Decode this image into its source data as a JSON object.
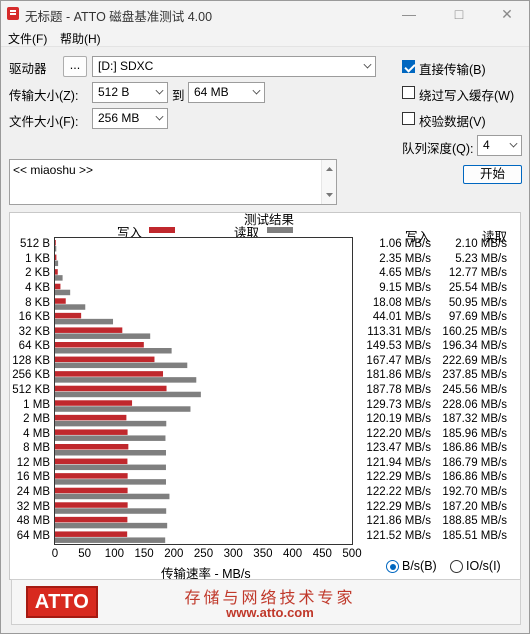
{
  "window": {
    "title": "无标题 - ATTO 磁盘基准测试 4.00"
  },
  "menu": {
    "file": "文件(F)",
    "help": "帮助(H)"
  },
  "controls": {
    "drive_label": "驱动器",
    "browse_button": "...",
    "drive_value": "[D:] SDXC",
    "transfer_size_label": "传输大小(Z):",
    "transfer_from": "512 B",
    "transfer_to_label": "到",
    "transfer_to": "64 MB",
    "file_size_label": "文件大小(F):",
    "file_size": "256 MB",
    "direct_io_label": "直接传输(B)",
    "direct_io_checked": true,
    "bypass_write_cache_label": "绕过写入缓存(W)",
    "bypass_write_cache_checked": false,
    "verify_data_label": "校验数据(V)",
    "verify_data_checked": false,
    "queue_depth_label": "队列深度(Q):",
    "queue_depth": "4",
    "start_button": "开始",
    "description": "<< miaoshu >>"
  },
  "results": {
    "title": "测试结果",
    "legend_write": "写入",
    "legend_read": "读取",
    "col_write": "写入",
    "col_read": "读取",
    "xlabel": "传输速率 - MB/s",
    "unit_bytes": "B/s(B)",
    "unit_io": "IO/s(I)",
    "unit_selected": "B/s"
  },
  "colors": {
    "write": "#c0282d",
    "read": "#7f7f7f",
    "accent": "#0067c0"
  },
  "banner": {
    "logo": "ATTO",
    "slogan": "存储与网络技术专家",
    "site": "www.atto.com"
  },
  "chart_data": {
    "type": "bar",
    "categories": [
      "512 B",
      "1 KB",
      "2 KB",
      "4 KB",
      "8 KB",
      "16 KB",
      "32 KB",
      "64 KB",
      "128 KB",
      "256 KB",
      "512 KB",
      "1 MB",
      "2 MB",
      "4 MB",
      "8 MB",
      "12 MB",
      "16 MB",
      "24 MB",
      "32 MB",
      "48 MB",
      "64 MB"
    ],
    "series": [
      {
        "name": "写入",
        "values": [
          1.06,
          2.35,
          4.65,
          9.15,
          18.08,
          44.01,
          113.31,
          149.53,
          167.47,
          181.86,
          187.78,
          129.73,
          120.19,
          122.2,
          123.47,
          121.94,
          122.29,
          122.22,
          122.29,
          121.86,
          121.52
        ],
        "labels": [
          "1.06 MB/s",
          "2.35 MB/s",
          "4.65 MB/s",
          "9.15 MB/s",
          "18.08 MB/s",
          "44.01 MB/s",
          "113.31 MB/s",
          "149.53 MB/s",
          "167.47 MB/s",
          "181.86 MB/s",
          "187.78 MB/s",
          "129.73 MB/s",
          "120.19 MB/s",
          "122.20 MB/s",
          "123.47 MB/s",
          "121.94 MB/s",
          "122.29 MB/s",
          "122.22 MB/s",
          "122.29 MB/s",
          "121.86 MB/s",
          "121.52 MB/s"
        ]
      },
      {
        "name": "读取",
        "values": [
          2.1,
          5.23,
          12.77,
          25.54,
          50.95,
          97.69,
          160.25,
          196.34,
          222.69,
          237.85,
          245.56,
          228.06,
          187.32,
          185.96,
          186.86,
          186.79,
          186.86,
          192.7,
          187.2,
          188.85,
          185.51
        ],
        "labels": [
          "2.10 MB/s",
          "5.23 MB/s",
          "12.77 MB/s",
          "25.54 MB/s",
          "50.95 MB/s",
          "97.69 MB/s",
          "160.25 MB/s",
          "196.34 MB/s",
          "222.69 MB/s",
          "237.85 MB/s",
          "245.56 MB/s",
          "228.06 MB/s",
          "187.32 MB/s",
          "185.96 MB/s",
          "186.86 MB/s",
          "186.79 MB/s",
          "186.86 MB/s",
          "192.70 MB/s",
          "187.20 MB/s",
          "188.85 MB/s",
          "185.51 MB/s"
        ]
      }
    ],
    "xlabel": "传输速率 - MB/s",
    "xlim": [
      0,
      500
    ],
    "xticks": [
      0,
      50,
      100,
      150,
      200,
      250,
      300,
      350,
      400,
      450,
      500
    ],
    "legend": "top"
  }
}
